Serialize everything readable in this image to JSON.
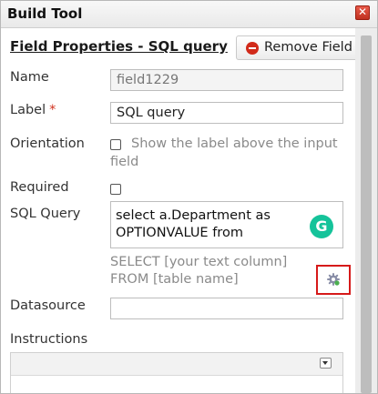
{
  "window": {
    "title": "Build Tool"
  },
  "header": {
    "heading": "Field Properties - SQL query",
    "remove_label": "Remove Field"
  },
  "fields": {
    "name": {
      "label": "Name",
      "value": "field1229"
    },
    "label": {
      "label": "Label",
      "required_mark": "*",
      "value": "SQL query"
    },
    "orientation": {
      "label": "Orientation",
      "hint_line1": "Show the label above the input",
      "hint_line2": "field",
      "checked": false
    },
    "required": {
      "label": "Required",
      "checked": false
    },
    "sql_query": {
      "label": "SQL Query",
      "value_line1": "select a.Department as",
      "value_line2": "OPTIONVALUE from",
      "hint_line1": "SELECT [your text column]",
      "hint_line2": "FROM [table name]"
    },
    "datasource": {
      "label": "Datasource",
      "value": ""
    },
    "instructions": {
      "label": "Instructions"
    }
  },
  "colors": {
    "highlight": "#d61a1a",
    "grammarly": "#15c39a",
    "required_star": "#d0311e"
  }
}
